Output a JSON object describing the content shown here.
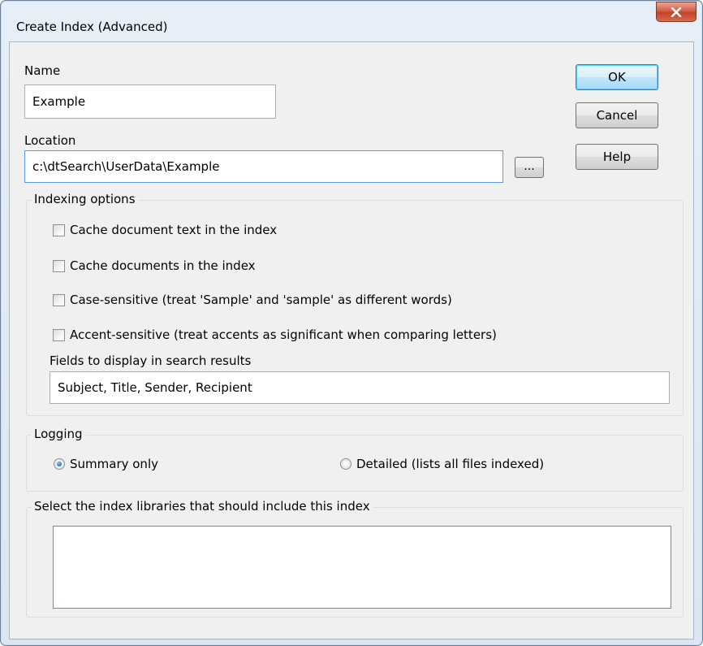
{
  "window": {
    "title": "Create Index (Advanced)",
    "close_glyph": "X"
  },
  "name": {
    "label": "Name",
    "value": "Example"
  },
  "location": {
    "label": "Location",
    "value": "c:\\dtSearch\\UserData\\Example",
    "browse_label": "..."
  },
  "buttons": {
    "ok": "OK",
    "cancel": "Cancel",
    "help": "Help"
  },
  "indexing_options": {
    "legend": "Indexing options",
    "options": [
      {
        "label": "Cache document text in the index",
        "checked": false
      },
      {
        "label": "Cache documents in the index",
        "checked": false
      },
      {
        "label": "Case-sensitive (treat 'Sample' and 'sample'  as different words)",
        "checked": false
      },
      {
        "label": "Accent-sensitive (treat accents as significant when comparing letters)",
        "checked": false
      }
    ],
    "fields_label": "Fields to display in search results",
    "fields_value": "Subject, Title, Sender, Recipient"
  },
  "logging": {
    "legend": "Logging",
    "summary_label": "Summary only",
    "detailed_label": "Detailed (lists all files indexed)",
    "selected": "summary"
  },
  "libraries": {
    "legend": "Select the index libraries that should include this index",
    "items": []
  }
}
